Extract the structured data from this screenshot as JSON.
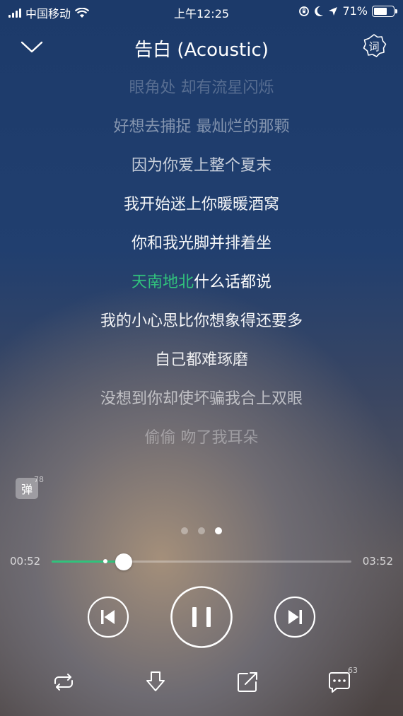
{
  "status_bar": {
    "carrier": "中国移动",
    "time": "上午12:25",
    "battery_percent": "71%",
    "battery_level": 0.71,
    "icons": [
      "signal-icon",
      "wifi-icon",
      "orientation-lock-icon",
      "moon-icon",
      "location-icon",
      "battery-icon"
    ]
  },
  "header": {
    "title": "告白 (Acoustic)",
    "lyric_button_label": "词"
  },
  "lyrics": {
    "lines": [
      {
        "text": "眼角处 却有流星闪烁",
        "opacity": 0.25
      },
      {
        "text": "好想去捕捉 最灿烂的那颗",
        "opacity": 0.45
      },
      {
        "text": "因为你爱上整个夏末",
        "opacity": 0.75
      },
      {
        "text": "我开始迷上你暖暖酒窝",
        "opacity": 0.95
      },
      {
        "text": "你和我光脚并排着坐",
        "opacity": 0.95
      },
      {
        "text_highlight": "天南地北",
        "text_rest": "什么话都说",
        "opacity": 1.0,
        "current": true
      },
      {
        "text": "我的小心思比你想象得还要多",
        "opacity": 0.95
      },
      {
        "text": "自己都难琢磨",
        "opacity": 0.9
      },
      {
        "text": "没想到你却使坏骗我合上双眼",
        "opacity": 0.6
      },
      {
        "text": "偷偷 吻了我耳朵",
        "opacity": 0.35
      }
    ]
  },
  "danmu": {
    "label": "弹",
    "count": "78"
  },
  "pager": {
    "pages": 3,
    "active_index": 2
  },
  "playback": {
    "current_time": "00:52",
    "total_time": "03:52",
    "played_fraction": 0.24,
    "buffered_fraction": 0.18
  },
  "controls": {
    "prev_icon": "skip-previous-icon",
    "play_pause_icon": "pause-icon",
    "next_icon": "skip-next-icon"
  },
  "bottom_bar": {
    "repeat_icon": "repeat-icon",
    "download_icon": "download-icon",
    "share_icon": "share-icon",
    "comment_icon": "comment-icon",
    "comment_count": "63"
  },
  "colors": {
    "accent": "#31c27c"
  }
}
